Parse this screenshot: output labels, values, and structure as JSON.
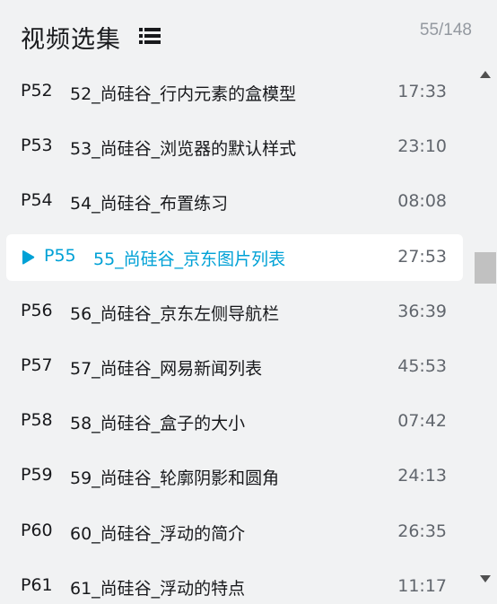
{
  "header": {
    "title": "视频选集",
    "count": "55/148",
    "list_icon": "list-icon"
  },
  "episodes": [
    {
      "page": "P52",
      "name": "52_尚硅谷_行内元素的盒模型",
      "duration": "17:33",
      "active": false
    },
    {
      "page": "P53",
      "name": "53_尚硅谷_浏览器的默认样式",
      "duration": "23:10",
      "active": false
    },
    {
      "page": "P54",
      "name": "54_尚硅谷_布置练习",
      "duration": "08:08",
      "active": false
    },
    {
      "page": "P55",
      "name": "55_尚硅谷_京东图片列表",
      "duration": "27:53",
      "active": true
    },
    {
      "page": "P56",
      "name": "56_尚硅谷_京东左侧导航栏",
      "duration": "36:39",
      "active": false
    },
    {
      "page": "P57",
      "name": "57_尚硅谷_网易新闻列表",
      "duration": "45:53",
      "active": false
    },
    {
      "page": "P58",
      "name": "58_尚硅谷_盒子的大小",
      "duration": "07:42",
      "active": false
    },
    {
      "page": "P59",
      "name": "59_尚硅谷_轮廓阴影和圆角",
      "duration": "24:13",
      "active": false
    },
    {
      "page": "P60",
      "name": "60_尚硅谷_浮动的简介",
      "duration": "26:35",
      "active": false
    },
    {
      "page": "P61",
      "name": "61_尚硅谷_浮动的特点",
      "duration": "11:17",
      "active": false
    }
  ],
  "colors": {
    "accent": "#00a1d6",
    "panel_bg": "#f1f2f3",
    "active_bg": "#ffffff",
    "text": "#18191c",
    "muted": "#9499a0",
    "scroll_thumb": "#c1c1c1"
  },
  "icons": {
    "active_marker": "play-indicator-icon",
    "scroll_up": "arrow-up-icon",
    "scroll_down": "arrow-down-icon"
  }
}
